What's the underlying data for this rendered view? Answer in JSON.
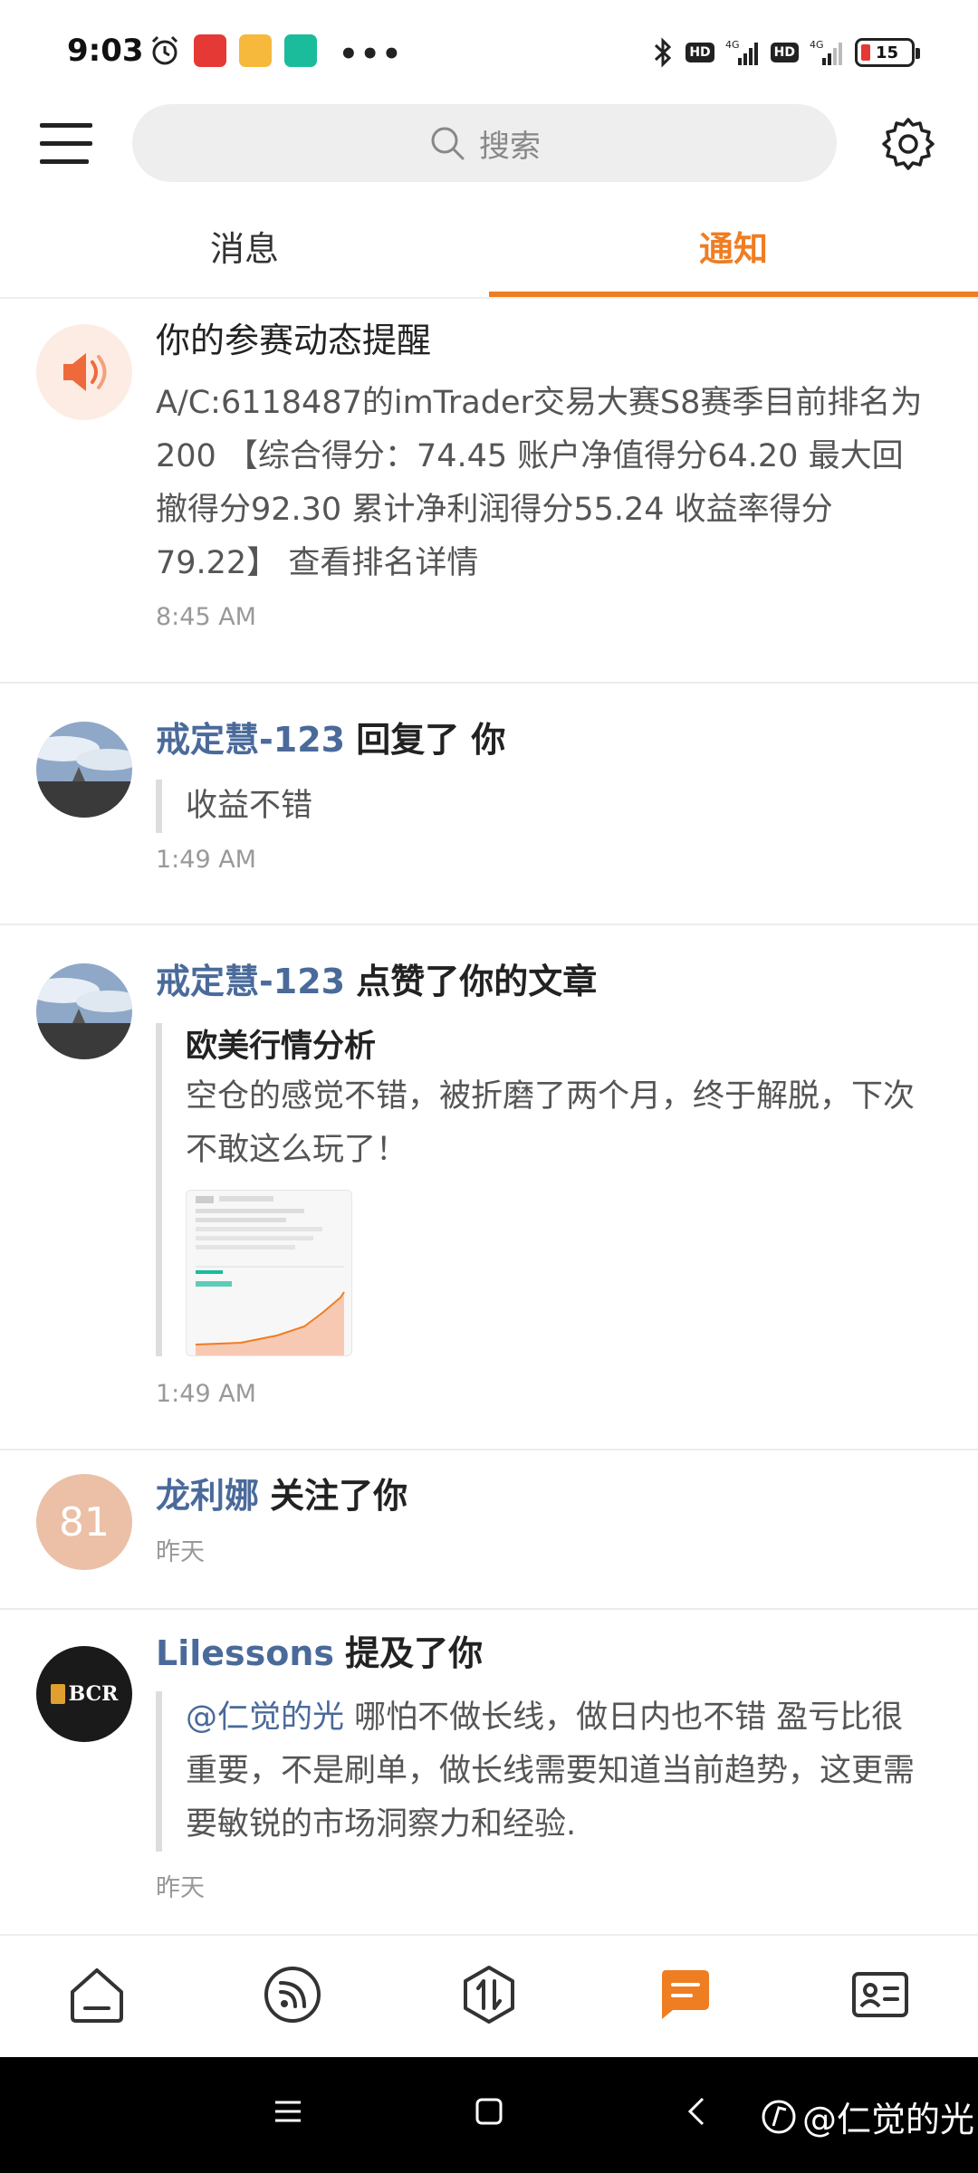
{
  "status_bar": {
    "time": "9:03",
    "hd1": "HD",
    "hd2": "HD",
    "net1": "4G",
    "net2": "4G",
    "battery": "15"
  },
  "header": {
    "search_placeholder": "搜索"
  },
  "tabs": [
    {
      "label": "消息",
      "active": false
    },
    {
      "label": "通知",
      "active": true
    }
  ],
  "accent_color": "#ef7d22",
  "link_color": "#4a6a9a",
  "notifications": [
    {
      "type": "system",
      "title": "你的参赛动态提醒",
      "body": "A/C:6118487的imTrader交易大赛S8赛季目前排名为200 【综合得分：74.45 账户净值得分64.20 最大回撤得分92.30 累计净利润得分55.24 收益率得分79.22】 查看排名详情",
      "time": "8:45 AM"
    },
    {
      "type": "reply",
      "user": "戒定慧-123",
      "action": "回复了 你",
      "quote": "收益不错",
      "time": "1:49 AM"
    },
    {
      "type": "like",
      "user": "戒定慧-123",
      "action": "点赞了你的文章",
      "article_title": "欧美行情分析",
      "article_excerpt": "空仓的感觉不错，被折磨了两个月，终于解脱，下次不敢这么玩了！",
      "time": "1:49 AM"
    },
    {
      "type": "follow",
      "avatar_text": "81",
      "user": "龙利娜",
      "action": "关注了你",
      "time": "昨天"
    },
    {
      "type": "mention",
      "avatar_text": "BCR",
      "user": "Lilessons",
      "action": "提及了你",
      "mention": "@仁觉的光",
      "quote": " 哪怕不做长线，做日内也不错 盈亏比很重要，不是刷单，做长线需要知道当前趋势，这更需要敏锐的市场洞察力和经验.",
      "time": "昨天"
    }
  ],
  "bottom_nav": [
    "home-icon",
    "feed-icon",
    "trade-icon",
    "message-icon",
    "profile-card-icon"
  ],
  "watermark": "@仁觉的光"
}
